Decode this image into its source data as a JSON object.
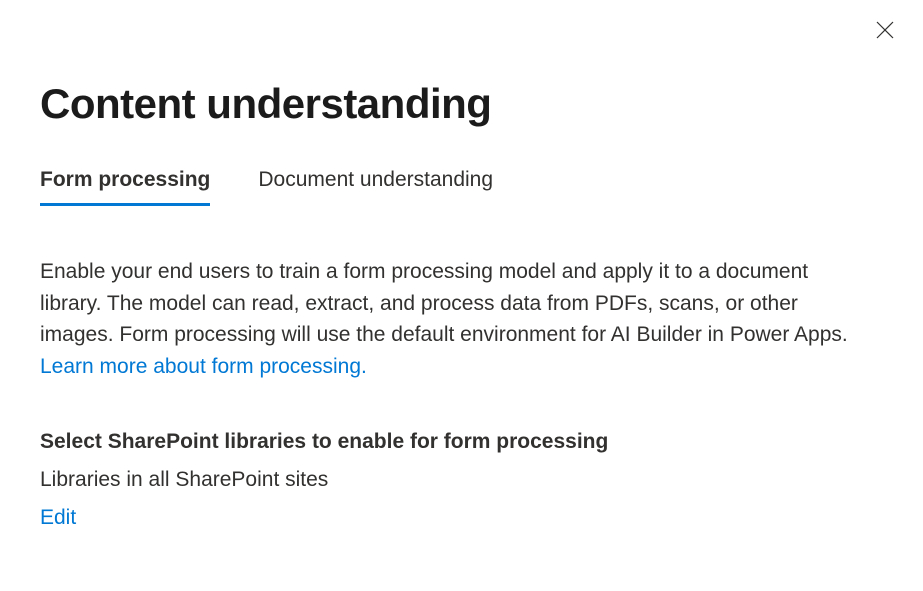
{
  "header": {
    "title": "Content understanding"
  },
  "tabs": [
    {
      "label": "Form processing",
      "active": true
    },
    {
      "label": "Document understanding",
      "active": false
    }
  ],
  "main": {
    "description_pre": "Enable your end users to train a form processing model and apply it to a document library. The model can read, extract, and process data from PDFs, scans, or other images. Form processing will use the default environment for AI Builder in Power Apps. ",
    "learn_more_label": "Learn more about form processing.",
    "section_heading": "Select SharePoint libraries to enable for form processing",
    "section_value": "Libraries in all SharePoint sites",
    "edit_label": "Edit"
  }
}
